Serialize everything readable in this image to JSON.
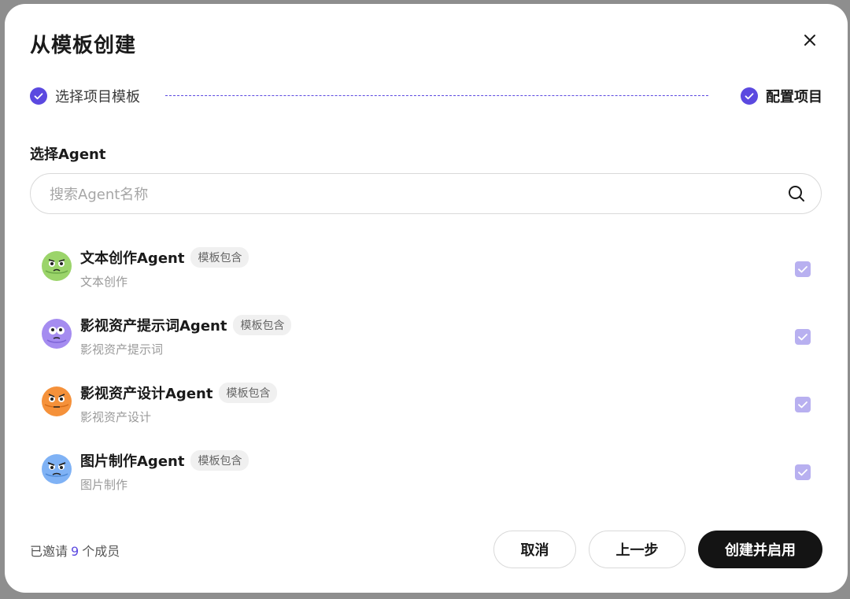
{
  "dialog": {
    "title": "从模板创建"
  },
  "steps": [
    {
      "label": "选择项目模板",
      "status": "done"
    },
    {
      "label": "配置项目",
      "status": "current"
    }
  ],
  "section": {
    "label": "选择Agent"
  },
  "search": {
    "placeholder": "搜索Agent名称",
    "value": ""
  },
  "agents": [
    {
      "name": "文本创作Agent",
      "badge": "模板包含",
      "desc": "文本创作",
      "checked": true,
      "avatar_color": "#9bd46a"
    },
    {
      "name": "影视资产提示词Agent",
      "badge": "模板包含",
      "desc": "影视资产提示词",
      "checked": true,
      "avatar_color": "#a58cf0"
    },
    {
      "name": "影视资产设计Agent",
      "badge": "模板包含",
      "desc": "影视资产设计",
      "checked": true,
      "avatar_color": "#f5913a"
    },
    {
      "name": "图片制作Agent",
      "badge": "模板包含",
      "desc": "图片制作",
      "checked": true,
      "avatar_color": "#7fb2f5"
    }
  ],
  "footer": {
    "invite_prefix": "已邀请",
    "invite_count": "9",
    "invite_suffix": "个成员",
    "cancel_label": "取消",
    "prev_label": "上一步",
    "create_label": "创建并启用"
  },
  "colors": {
    "accent": "#5b49e0",
    "primary_button": "#141414",
    "checkbox_checked": "#b8b0f0"
  }
}
